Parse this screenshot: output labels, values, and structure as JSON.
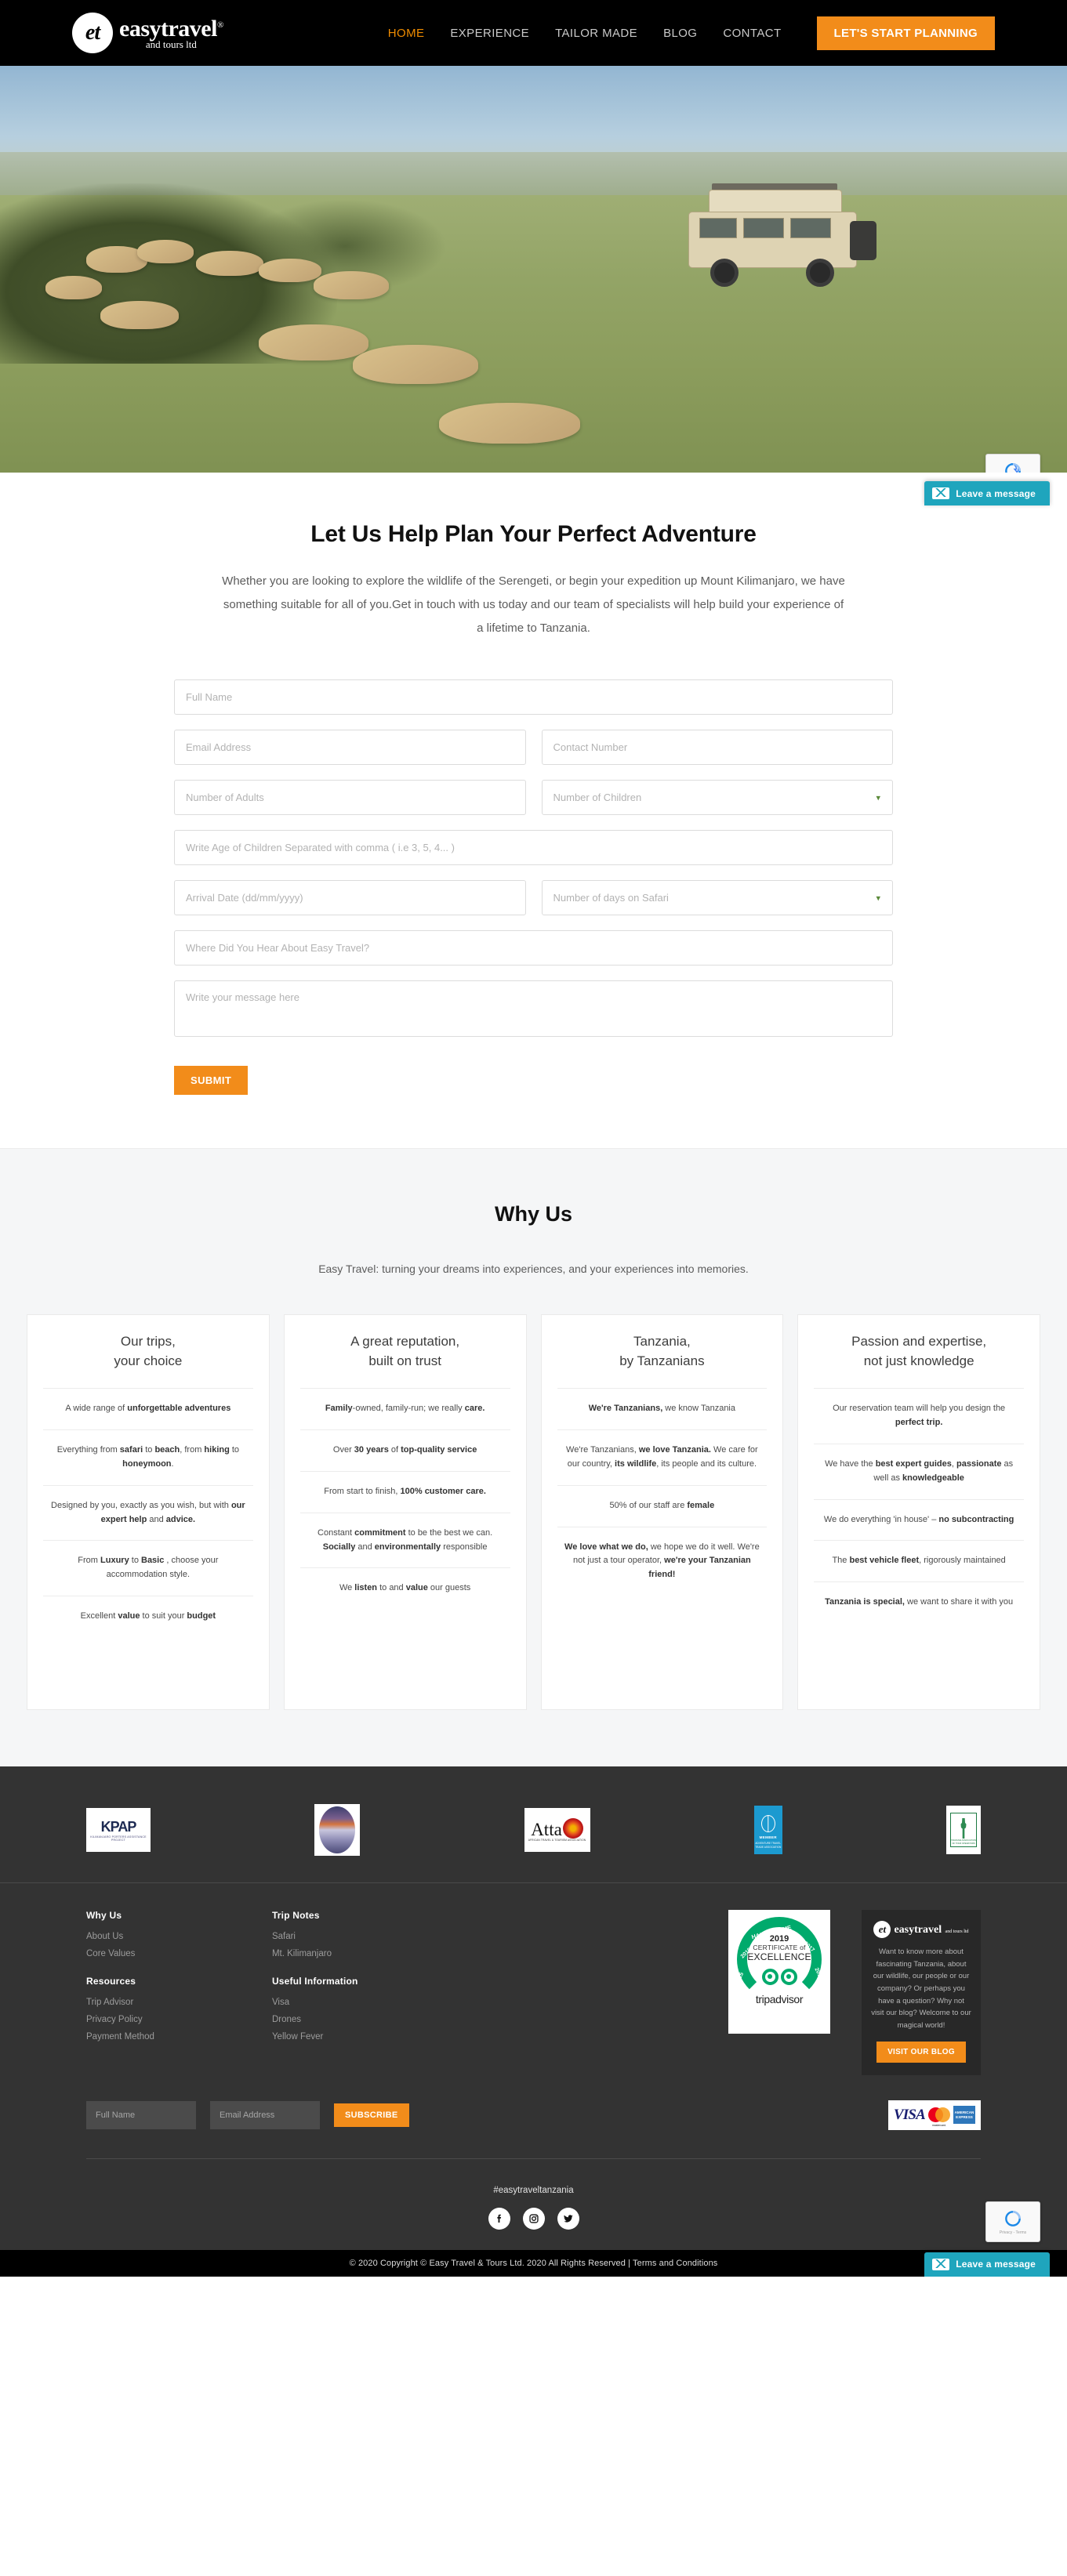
{
  "brand": {
    "badge": "et",
    "name": "easytravel",
    "registered": "®",
    "tagline": "and tours ltd"
  },
  "header": {
    "nav": [
      {
        "label": "HOME",
        "active": true
      },
      {
        "label": "EXPERIENCE",
        "active": false
      },
      {
        "label": "TAILOR MADE",
        "active": false
      },
      {
        "label": "BLOG",
        "active": false
      },
      {
        "label": "CONTACT",
        "active": false
      }
    ],
    "cta_label": "LET'S START PLANNING"
  },
  "chat_widget": {
    "label": "Leave a message",
    "icon": "envelope-icon"
  },
  "recaptcha": {
    "label": "Privacy - Terms"
  },
  "form_section": {
    "title": "Let Us Help Plan Your Perfect Adventure",
    "description": "Whether you are looking to explore the wildlife of the Serengeti, or begin your expedition up Mount Kilimanjaro, we have something suitable for all of you.Get in touch with us today and our team of specialists will help build your experience of a lifetime to Tanzania.",
    "fields": {
      "full_name": "Full Name",
      "email": "Email Address",
      "contact": "Contact Number",
      "adults": "Number of Adults",
      "children": "Number of Children",
      "children_ages": "Write Age of Children Separated with comma ( i.e 3, 5, 4... )",
      "arrival_date": "Arrival Date (dd/mm/yyyy)",
      "days_safari": "Number of days on Safari",
      "hear_about": "Where Did You Hear About Easy Travel?",
      "message": "Write your message here"
    },
    "submit_label": "SUBMIT"
  },
  "why_us": {
    "title": "Why Us",
    "subtitle": "Easy Travel: turning your dreams into experiences, and your experiences into memories.",
    "cards": [
      {
        "title_line1": "Our trips,",
        "title_line2": "your choice",
        "items": [
          "A wide range of <b>unforgettable adventures</b>",
          "Everything from <b>safari</b> to <b>beach</b>, from <b>hiking</b> to <b>honeymoon</b>.",
          "Designed by you, exactly as you wish, but with <b>our expert help</b> and <b>advice.</b>",
          "From <b>Luxury</b> to <b>Basic</b> , choose your accommodation style.",
          "Excellent <b>value</b> to suit your <b>budget</b>"
        ]
      },
      {
        "title_line1": "A great reputation,",
        "title_line2": "built on trust",
        "items": [
          "<b>Family</b>-owned, family-run; we really <b>care.</b>",
          "Over <b>30 years</b> of <b>top-quality service</b>",
          "From start to finish, <b>100% customer care.</b>",
          "Constant <b>commitment</b> to be the best we can. <b>Socially</b> and <b>environmentally</b> responsible",
          "We <b>listen</b> to and <b>value</b> our guests"
        ]
      },
      {
        "title_line1": "Tanzania,",
        "title_line2": "by Tanzanians",
        "items": [
          "<b>We're Tanzanians,</b> we know Tanzania",
          "We're Tanzanians, <b>we love Tanzania.</b> We care for our country, <b>its wildlife</b>, its people and its culture.",
          "50% of our staff are <b>female</b>",
          "<b>We love what we do,</b> we hope we do it well. We're not just a tour operator, <b>we're your Tanzanian friend!</b>"
        ]
      },
      {
        "title_line1": "Passion and expertise,",
        "title_line2": "not just knowledge",
        "items": [
          "Our reservation team will help you design the <b>perfect trip.</b>",
          "We have the <b>best expert guides</b>, <b>passionate</b> as well as <b>knowledgeable</b>",
          "We do everything 'in house' – <b>no subcontracting</b>",
          "The <b>best vehicle fleet</b>, rigorously maintained",
          "<b>Tanzania is special,</b> we want to share it with you"
        ]
      }
    ]
  },
  "footer": {
    "partners": [
      {
        "name": "kpap-logo",
        "text": "KPAP",
        "sub": "KILIMANJARO PORTERS ASSISTANCE PROJECT"
      },
      {
        "name": "mountain-logo",
        "text": ""
      },
      {
        "name": "atta-logo",
        "text": "Atta",
        "sub": "AFRICAN TRAVEL & TOURISM ASSOCIATION"
      },
      {
        "name": "atta-member-logo",
        "text": "MEMBER",
        "sub": "ADVENTURE TRAVEL TRADE ASSOCIATION"
      },
      {
        "name": "tato-logo",
        "text": "",
        "sub": "TANZANIA ASSOCIATION OF TOUR OPERATORS"
      }
    ],
    "columns": [
      {
        "groups": [
          {
            "heading": "Why Us",
            "links": [
              "About Us",
              "Core Values"
            ]
          },
          {
            "heading": "Resources",
            "links": [
              "Trip Advisor",
              "Privacy Policy",
              "Payment Method"
            ]
          }
        ]
      },
      {
        "groups": [
          {
            "heading": "Trip Notes",
            "links": [
              "Safari",
              "Mt. Kilimanjaro"
            ]
          },
          {
            "heading": "Useful Information",
            "links": [
              "Visa",
              "Drones",
              "Yellow Fever"
            ]
          }
        ]
      }
    ],
    "tripadvisor": {
      "hall_of_fame": "HALL of FAME",
      "years": [
        "2015",
        "2016",
        "2017",
        "2018"
      ],
      "year_main": "2019",
      "certificate": "CERTIFICATE of",
      "excellence": "EXCELLENCE",
      "brand": "tripadvisor",
      "registered": "®"
    },
    "blog_box": {
      "text": "Want to know more about fascinating Tanzania, about our wildlife, our people or our company? Or perhaps you have a question? Why not visit our blog? Welcome to our magical world!",
      "button_label": "VISIT OUR BLOG"
    },
    "newsletter": {
      "name_placeholder": "Full Name",
      "email_placeholder": "Email Address",
      "button_label": "SUBSCRIBE"
    },
    "payment_cards": [
      "VISA",
      "mastercard.",
      "AMERICAN EXPRESS"
    ],
    "hashtag": "#easytraveltanzania",
    "socials": [
      "facebook-icon",
      "instagram-icon",
      "twitter-icon"
    ],
    "copyright": "© 2020 Copyright © Easy Travel & Tours Ltd. 2020 All Rights Reserved | Terms and Conditions"
  },
  "colors": {
    "accent": "#f28c1a",
    "nav_active": "#f08c00",
    "chat": "#1fa5bd",
    "footer_bg": "#333333",
    "tripadvisor_green": "#00aa6c"
  }
}
